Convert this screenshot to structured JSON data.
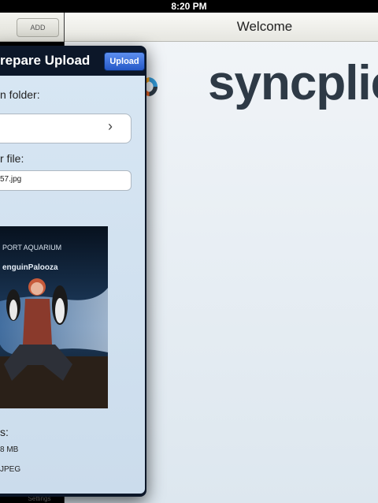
{
  "status_bar": {
    "time": "8:20 PM"
  },
  "master": {
    "add_label": "ADD",
    "settings_label": "Settings"
  },
  "welcome": {
    "title": "Welcome",
    "brand_name": "syncplie"
  },
  "popover": {
    "title": "repare Upload",
    "upload_label": "Upload",
    "folder_label": "n folder:",
    "file_label": "r file:",
    "file_name": "57.jpg",
    "photo_sign_line1": "PORT AQUARIUM",
    "photo_sign_line2": "enguinPalooza",
    "details_label": "s:",
    "size_value": "8 MB",
    "type_value": "JPEG"
  },
  "colors": {
    "upload_button": "#2f63d6",
    "popover_frame": "#0c1729",
    "popover_content": "#d3e3f1",
    "brand_text": "#2e3a46",
    "logo_orange": "#f26522",
    "logo_blue": "#3399d6",
    "logo_dark": "#2e3a46"
  },
  "icons": {
    "chevron": "chevron-right-icon",
    "logo": "syncplicity-logo"
  }
}
